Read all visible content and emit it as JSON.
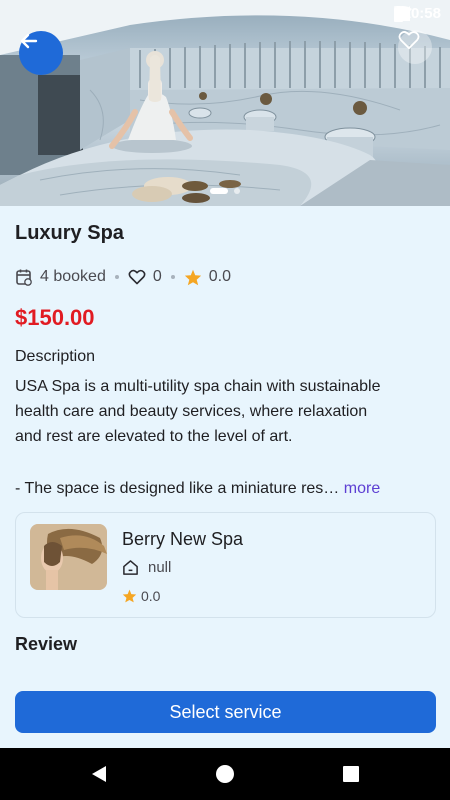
{
  "status_bar": {
    "time": "10:58",
    "icons": [
      "wifi-icon",
      "signal-icon",
      "sim-icon",
      "battery-icon"
    ]
  },
  "hero": {
    "image": "spa-hammam-photo",
    "carousel_pages": 2,
    "carousel_active_index": 0
  },
  "header_buttons": {
    "back_icon": "arrow-left-icon",
    "favorite_icon": "heart-outline-icon"
  },
  "service": {
    "title": "Luxury Spa",
    "booked": "4 booked",
    "likes": "0",
    "rating": "0.0",
    "price": "$150.00",
    "description_heading": "Description",
    "description_lines": [
      "USA Spa is a multi-utility spa chain with sustainable",
      "health care and beauty services, where relaxation",
      "and rest are elevated to the level of art."
    ],
    "description_last": "- The space is designed like a miniature res…",
    "more_label": "more"
  },
  "provider": {
    "name": "Berry New Spa",
    "address": "null",
    "rating": "0.0"
  },
  "review_heading": "Review",
  "cta_label": "Select service",
  "colors": {
    "primary": "#1f6ad8",
    "price": "#e11b22",
    "background": "#e8f5fd",
    "star": "#f5a623",
    "link": "#5d3fd3"
  },
  "nav_bar": {
    "buttons": [
      "back-triangle-icon",
      "home-circle-icon",
      "recents-square-icon"
    ]
  }
}
